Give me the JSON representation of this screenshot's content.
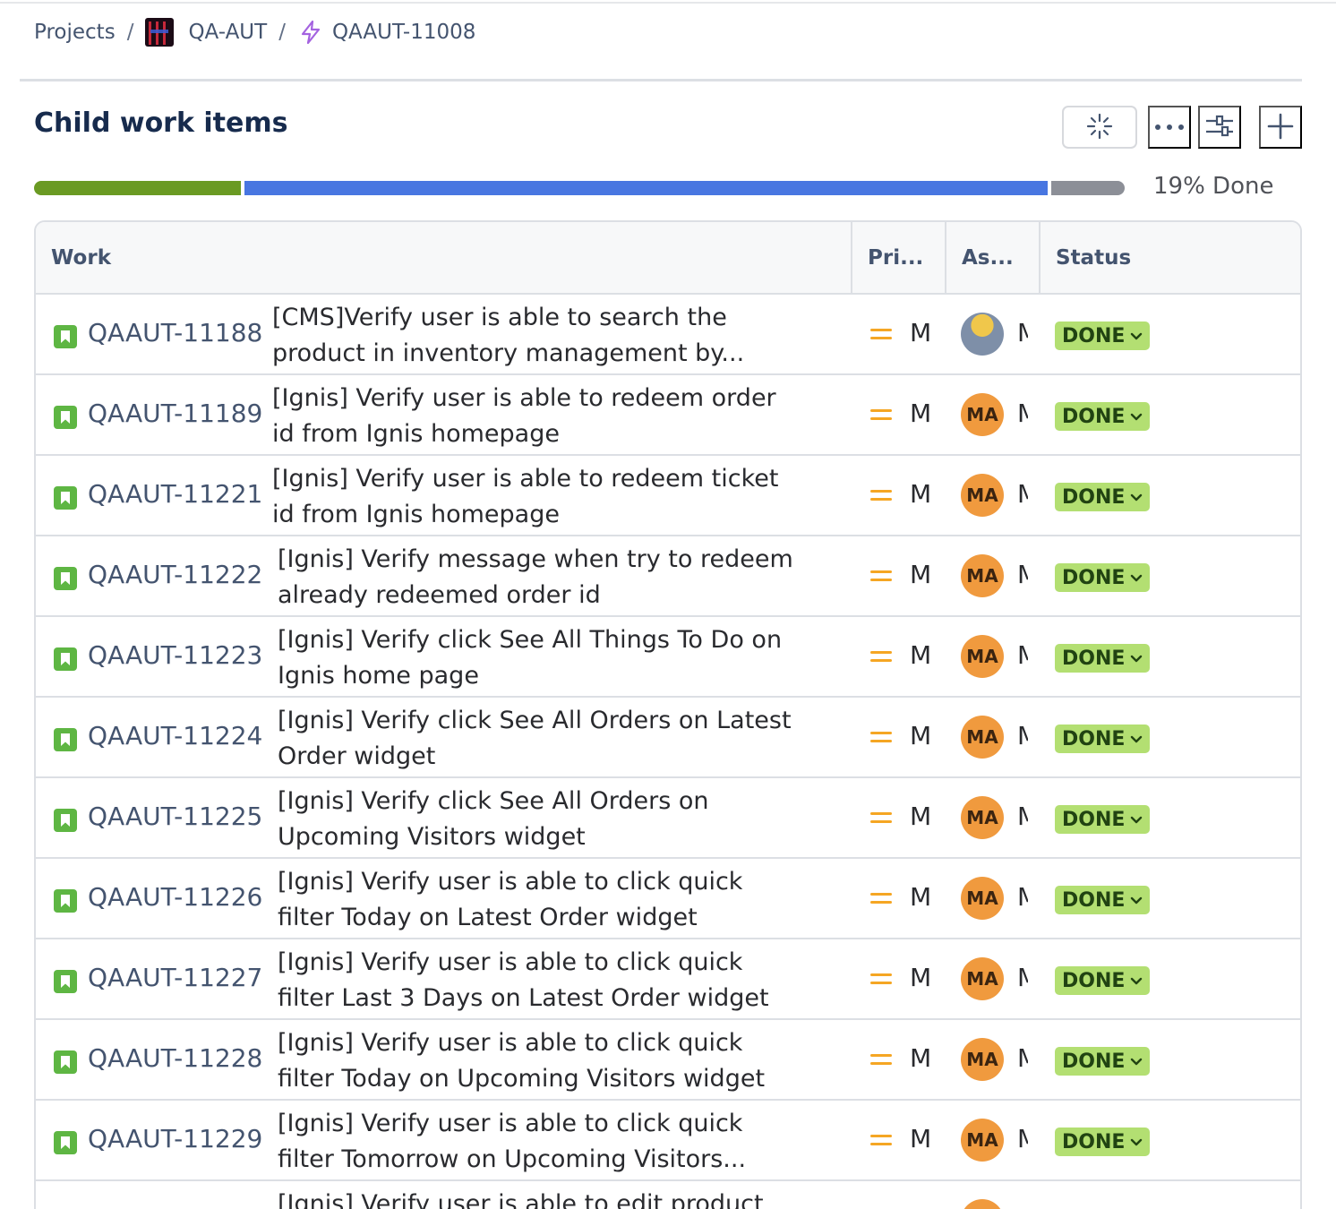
{
  "breadcrumb": {
    "projects": "Projects",
    "separator": "/",
    "project": "QA-AUT",
    "issue": "QAAUT-11008"
  },
  "section": {
    "title": "Child work items",
    "ai_icon": "sparkle-loading-icon",
    "more_icon": "more-horizontal-icon",
    "filter_icon": "filter-sliders-icon",
    "add_icon": "plus-icon"
  },
  "progress": {
    "label": "19% Done",
    "done_fraction": 0.19,
    "in_progress_fraction": 0.74,
    "todo_fraction": 0.07,
    "colors": {
      "done": "#6a9a23",
      "in_progress": "#4876e1",
      "todo": "#8c8f97"
    }
  },
  "table": {
    "columns": [
      "Work",
      "Pri...",
      "As...",
      "Status"
    ],
    "rows": [
      {
        "key": "QAAUT-11188",
        "summary": "[CMS]Verify user is able to search the product in inventory management by...",
        "priority": "M",
        "assignee_initials": "",
        "assignee_photo": true,
        "assignee": "M",
        "status": "DONE"
      },
      {
        "key": "QAAUT-11189",
        "summary": "[Ignis] Verify user is able to redeem order id from Ignis homepage",
        "priority": "M",
        "assignee_initials": "MA",
        "assignee_photo": false,
        "assignee": "M",
        "status": "DONE"
      },
      {
        "key": "QAAUT-11221",
        "summary": "[Ignis] Verify user is able to redeem ticket id from Ignis homepage",
        "priority": "M",
        "assignee_initials": "MA",
        "assignee_photo": false,
        "assignee": "M",
        "status": "DONE"
      },
      {
        "key": "QAAUT-11222",
        "summary": "[Ignis] Verify message when try to redeem already redeemed order id",
        "priority": "M",
        "assignee_initials": "MA",
        "assignee_photo": false,
        "assignee": "M",
        "status": "DONE"
      },
      {
        "key": "QAAUT-11223",
        "summary": "[Ignis] Verify click See All Things To Do on Ignis home page",
        "priority": "M",
        "assignee_initials": "MA",
        "assignee_photo": false,
        "assignee": "M",
        "status": "DONE"
      },
      {
        "key": "QAAUT-11224",
        "summary": "[Ignis] Verify click See All Orders on Latest Order widget",
        "priority": "M",
        "assignee_initials": "MA",
        "assignee_photo": false,
        "assignee": "M",
        "status": "DONE"
      },
      {
        "key": "QAAUT-11225",
        "summary": "[Ignis] Verify click See All Orders on Upcoming Visitors widget",
        "priority": "M",
        "assignee_initials": "MA",
        "assignee_photo": false,
        "assignee": "M",
        "status": "DONE"
      },
      {
        "key": "QAAUT-11226",
        "summary": "[Ignis] Verify user is able to click quick filter Today on Latest Order widget",
        "priority": "M",
        "assignee_initials": "MA",
        "assignee_photo": false,
        "assignee": "M",
        "status": "DONE"
      },
      {
        "key": "QAAUT-11227",
        "summary": "[Ignis] Verify user is able to click quick filter Last 3 Days on Latest Order widget",
        "priority": "M",
        "assignee_initials": "MA",
        "assignee_photo": false,
        "assignee": "M",
        "status": "DONE"
      },
      {
        "key": "QAAUT-11228",
        "summary": "[Ignis] Verify user is able to click quick filter Today on Upcoming Visitors widget",
        "priority": "M",
        "assignee_initials": "MA",
        "assignee_photo": false,
        "assignee": "M",
        "status": "DONE"
      },
      {
        "key": "QAAUT-11229",
        "summary": "[Ignis] Verify user is able to click quick filter Tomorrow on Upcoming Visitors...",
        "priority": "M",
        "assignee_initials": "MA",
        "assignee_photo": false,
        "assignee": "M",
        "status": "DONE"
      },
      {
        "key": "",
        "summary": "[Ignis] Verify user is able to edit product",
        "priority": "",
        "assignee_initials": "",
        "assignee_photo": false,
        "assignee": "",
        "status": ""
      }
    ]
  },
  "colors": {
    "accent": "#4876e1",
    "status_done_bg": "#b3df72",
    "avatar_bg": "#f09a3e",
    "story_icon": "#5eb643",
    "priority_medium": "#f5a623"
  }
}
